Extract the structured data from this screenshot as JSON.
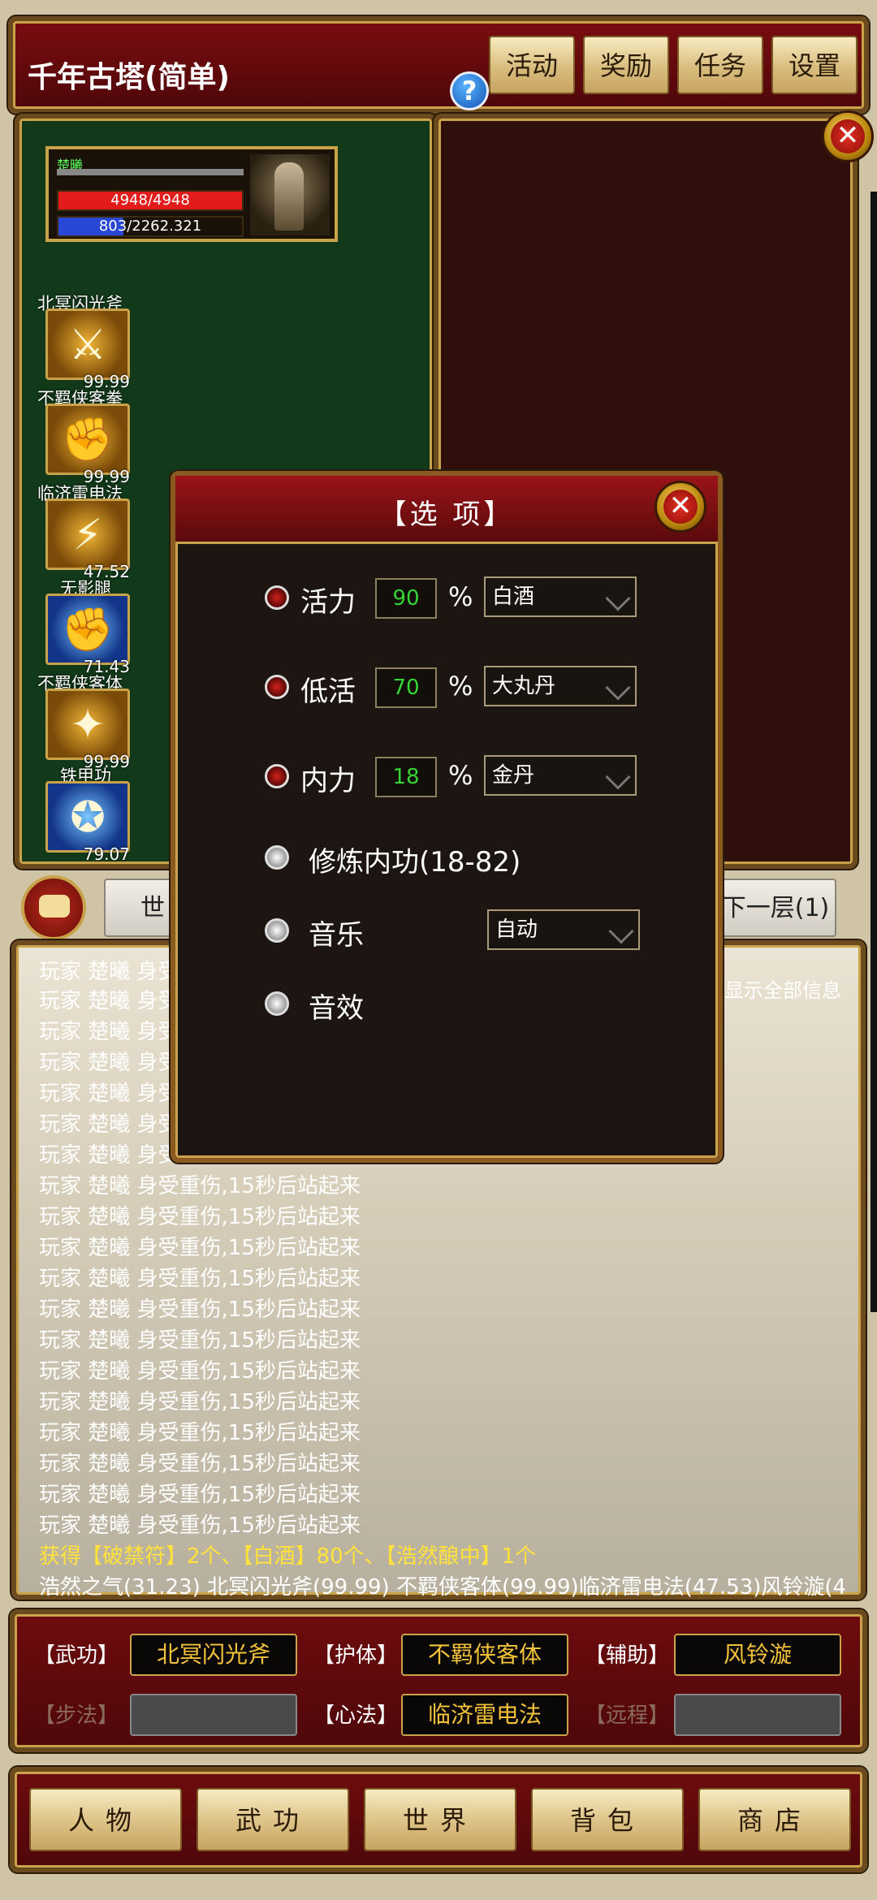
{
  "header": {
    "title": "千年古塔(简单)",
    "help_glyph": "?",
    "buttons": [
      "活动",
      "奖励",
      "任务",
      "设置"
    ]
  },
  "character": {
    "name": "楚曦",
    "hp_text": "4948/4948",
    "mp_text": "803/2262.321",
    "hp_fraction": 1.0,
    "mp_fraction": 0.355
  },
  "skills": [
    {
      "name": "北冥闪光斧",
      "value": "99.99",
      "icon": "axe-icon",
      "glyph": "⚔",
      "color": "gold"
    },
    {
      "name": "不羁侠客拳",
      "value": "99.99",
      "icon": "fist-icon",
      "glyph": "✊",
      "color": "gold"
    },
    {
      "name": "临济雷电法",
      "value": "47.52",
      "icon": "lightning-icon",
      "glyph": "⚡",
      "color": "gold"
    },
    {
      "name": "无影腿",
      "value": "71.43",
      "icon": "kick-icon",
      "glyph": "✊",
      "color": "blue"
    },
    {
      "name": "不羁侠客体",
      "value": "99.99",
      "icon": "body-icon",
      "glyph": "✦",
      "color": "gold"
    },
    {
      "name": "铁甲功",
      "value": "79.07",
      "icon": "armor-icon",
      "glyph": "✪",
      "color": "blue"
    }
  ],
  "strip": {
    "left_button": "世",
    "right_button": "下一层(1)"
  },
  "dialog": {
    "title": "【选 项】",
    "rows": [
      {
        "label": "活力",
        "value": "90",
        "pct": "%",
        "select": "白酒",
        "checked": true
      },
      {
        "label": "低活",
        "value": "70",
        "pct": "%",
        "select": "大丸丹",
        "checked": true
      },
      {
        "label": "内力",
        "value": "18",
        "pct": "%",
        "select": "金丹",
        "checked": true
      }
    ],
    "train_label": "修炼内功(18-82)",
    "music_label": "音乐",
    "music_select": "自动",
    "sfx_label": "音效"
  },
  "log": {
    "show_all": "显示全部信息",
    "partial_line": "玩家 楚曦 身受",
    "line": "玩家 楚曦 身受重伤,15秒后站起来",
    "gain": "获得【破禁符】2个、【白酒】80个、【浩然酿中】1个",
    "status": "浩然之气(31.23) 北冥闪光斧(99.99) 不羁侠客体(99.99)临济雷电法(47.53)风铃漩(4"
  },
  "equip": {
    "wugong_label": "【武功】",
    "wugong_value": "北冥闪光斧",
    "huti_label": "【护体】",
    "huti_value": "不羁侠客体",
    "fuzhu_label": "【辅助】",
    "fuzhu_value": "风铃漩",
    "bufa_label": "【步法】",
    "xinfa_label": "【心法】",
    "xinfa_value": "临济雷电法",
    "yuancheng_label": "【远程】"
  },
  "nav": [
    "人物",
    "武功",
    "世界",
    "背包",
    "商店"
  ],
  "colors": {
    "panel_red": "#6e0c0e",
    "gold": "#c9a24a",
    "green_value": "#34d534",
    "log_yellow": "#ffe23a"
  }
}
